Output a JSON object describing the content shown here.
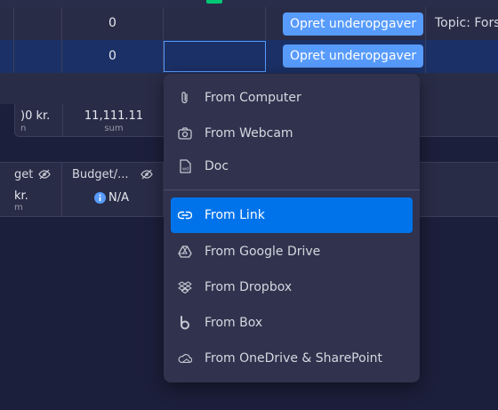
{
  "table": {
    "row1": {
      "count": "0",
      "button_label": "Opret underopgaver",
      "topic_text": "Topic: Forsi"
    },
    "row2": {
      "count": "0",
      "button_label": "Opret underopgaver"
    },
    "summary": {
      "left_value": ")0 kr.",
      "left_sub": "n",
      "sum_value": "11,111.11",
      "sum_label": "sum"
    },
    "budget_row": {
      "left_header": "get",
      "left_value": "kr.",
      "left_sub": "m",
      "right_header": "Budget/...",
      "right_value": "N/A"
    }
  },
  "menu": {
    "items": [
      {
        "label": "From Computer",
        "icon": "paperclip-icon"
      },
      {
        "label": "From Webcam",
        "icon": "camera-icon"
      },
      {
        "label": "Doc",
        "icon": "doc-icon"
      },
      {
        "label": "From Link",
        "icon": "link-icon"
      },
      {
        "label": "From Google Drive",
        "icon": "google-drive-icon"
      },
      {
        "label": "From Dropbox",
        "icon": "dropbox-icon"
      },
      {
        "label": "From Box",
        "icon": "box-icon"
      },
      {
        "label": "From OneDrive & SharePoint",
        "icon": "onedrive-icon"
      }
    ],
    "active_item": "From Link"
  },
  "colors": {
    "background": "#1c1f3b",
    "selected_row": "#1b3066",
    "button_blue": "#579bfc",
    "menu_active": "#0073ea",
    "info_icon": "#579bfc"
  }
}
